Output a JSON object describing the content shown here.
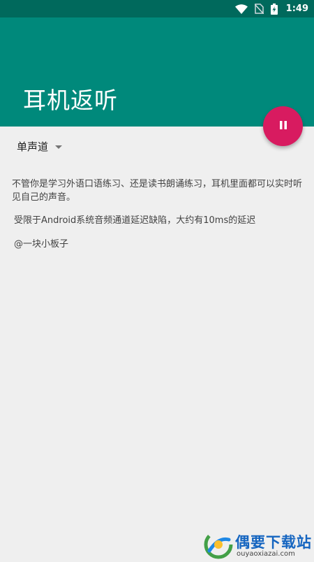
{
  "status_bar": {
    "time": "1:49",
    "icons": [
      "wifi-icon",
      "no-sim-icon",
      "battery-charging-icon"
    ]
  },
  "app_bar": {
    "title": "耳机返听",
    "color": "#00897b"
  },
  "fab": {
    "icon": "pause-icon",
    "color": "#d81b60"
  },
  "mode_select": {
    "selected": "单声道"
  },
  "content": {
    "paragraph_1": "不管你是学习外语口语练习、还是读书朗诵练习，耳机里面都可以实时听见自己的声音。",
    "paragraph_2": "受限于Android系统音频通道延迟缺陷，大约有10ms的延迟",
    "author": "@一块小板子"
  },
  "watermark": {
    "title": "偶要下载站",
    "url": "ouyaoxiazai.com"
  }
}
